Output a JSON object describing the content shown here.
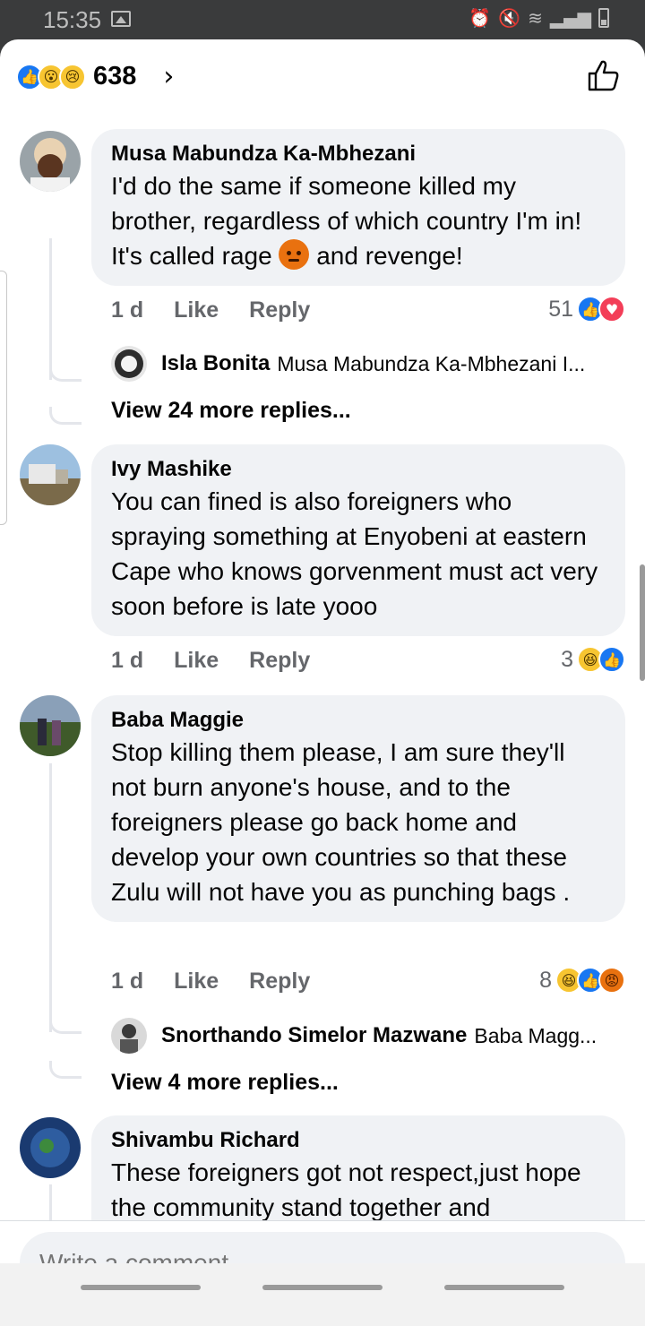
{
  "status_bar": {
    "time": "15:35"
  },
  "header": {
    "reaction_count": "638"
  },
  "comments": [
    {
      "author": "Musa Mabundza Ka-Mbhezani",
      "text_before_emoji": "I'd do the same if someone killed my brother, regardless of which country I'm in!  It's called rage",
      "text_after_emoji": "and revenge!",
      "time": "1 d",
      "like": "Like",
      "reply": "Reply",
      "reaction_count": "51",
      "reactions": [
        "like",
        "love"
      ],
      "reply_preview": {
        "name": "Isla Bonita",
        "text": "Musa Mabundza Ka-Mbhezani I..."
      },
      "more_replies": "View 24 more replies..."
    },
    {
      "author": "Ivy Mashike",
      "text": "You can fined is also foreigners who spraying something at Enyobeni at eastern Cape who knows gorvenment must act very soon before is late yooo",
      "time": "1 d",
      "like": "Like",
      "reply": "Reply",
      "reaction_count": "3",
      "reactions": [
        "haha",
        "like"
      ]
    },
    {
      "author": "Baba Maggie",
      "text": "Stop killing them please,  I am sure they'll not burn anyone's house,  and to the foreigners please go back home and develop your own countries so that these Zulu will not have you as punching bags .",
      "time": "1 d",
      "like": "Like",
      "reply": "Reply",
      "reaction_count": "8",
      "reactions": [
        "haha",
        "like",
        "angry"
      ],
      "reply_preview": {
        "name": "Snorthando Simelor Mazwane",
        "text": "Baba Magg..."
      },
      "more_replies": "View 4 more replies..."
    },
    {
      "author": "Shivambu Richard",
      "text": "These foreigners got not respect,just hope the community stand together and"
    }
  ],
  "composer": {
    "placeholder": "Write a comment..."
  },
  "colors": {
    "brand": "#1877f2",
    "bubble": "#f0f2f5",
    "muted": "#65676b"
  }
}
